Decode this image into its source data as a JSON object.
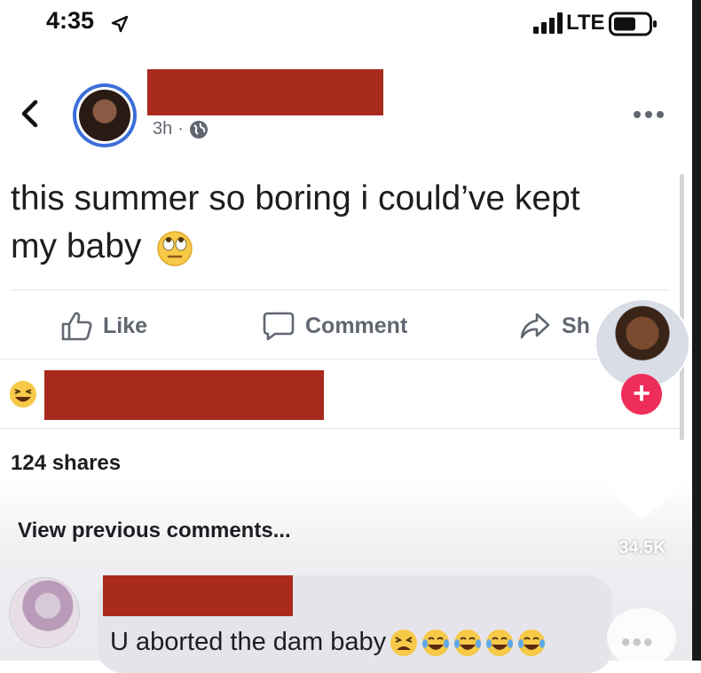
{
  "status_bar": {
    "time": "4:35",
    "network": "LTE",
    "icons": [
      "location-arrow-icon",
      "signal-bars-icon",
      "battery-icon"
    ]
  },
  "post": {
    "timestamp": "3h",
    "separator": "·",
    "privacy_icon": "globe-icon",
    "text_line1": "this summer so boring i could’ve kept",
    "text_line2": "my baby",
    "emoji": "face-with-rolling-eyes"
  },
  "actions": {
    "like": "Like",
    "comment": "Comment",
    "share": "Sh"
  },
  "reactions": {
    "emoji": "grinning-squinting-face"
  },
  "shares": "124 shares",
  "comments": {
    "view_previous": "View previous comments...",
    "first_comment_text": "U aborted the dam baby",
    "emojis": [
      "tired-face",
      "face-with-tears-of-joy",
      "face-with-tears-of-joy",
      "face-with-tears-of-joy",
      "face-with-tears-of-joy"
    ]
  },
  "tiktok_overlay": {
    "follow": "+",
    "like_count": "34.5K",
    "more": "•••"
  },
  "colors": {
    "redaction": "#a82a1c",
    "avatar_ring": "#3b6fd8",
    "follow_button": "#ef2d5a",
    "muted_text": "#606770"
  }
}
